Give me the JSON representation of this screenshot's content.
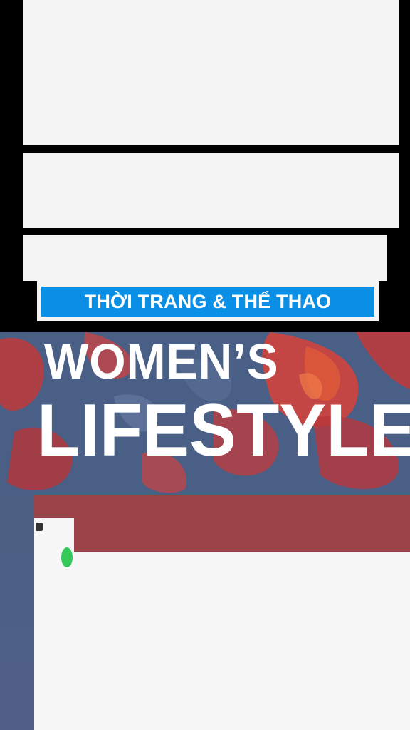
{
  "banner": {
    "text": "THỜI TRANG & THỂ THAO"
  },
  "headline": {
    "line1": "WOMEN’S",
    "line2": "LIFESTYLE"
  },
  "colors": {
    "background": "#000000",
    "banner_blue": "#0a8fe6",
    "camo_blue": "#4a5f86",
    "camo_red": "#c63a3a",
    "band_red": "#9b4248",
    "white": "#f6f6f6",
    "accent_green": "#37c85a"
  }
}
